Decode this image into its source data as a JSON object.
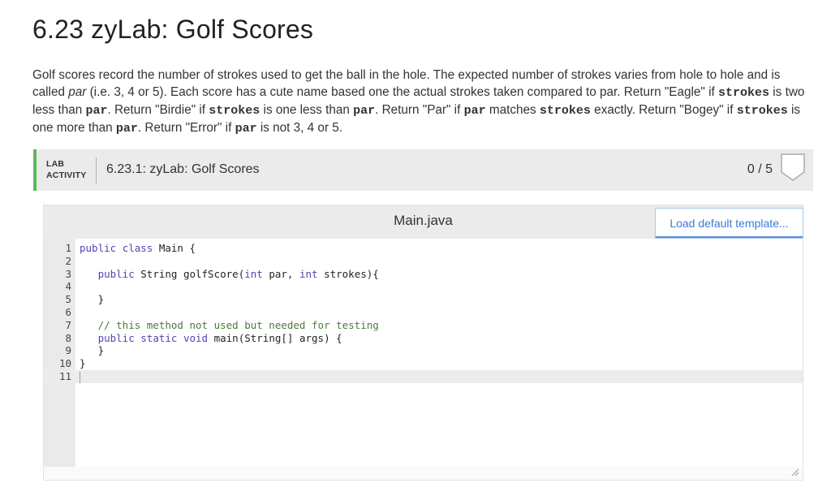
{
  "page": {
    "title": "6.23 zyLab: Golf Scores",
    "description": [
      {
        "t": "text",
        "v": "Golf scores record the number of strokes used to get the ball in the hole. The expected number of strokes varies from hole to hole and is called "
      },
      {
        "t": "em",
        "v": "par"
      },
      {
        "t": "text",
        "v": " (i.e. 3, 4 or 5). Each score has a cute name based one the actual strokes taken compared to par. Return \"Eagle\" if "
      },
      {
        "t": "code",
        "v": "strokes"
      },
      {
        "t": "text",
        "v": " is two less than "
      },
      {
        "t": "code",
        "v": "par"
      },
      {
        "t": "text",
        "v": ". Return \"Birdie\" if "
      },
      {
        "t": "code",
        "v": "strokes"
      },
      {
        "t": "text",
        "v": " is one less than "
      },
      {
        "t": "code",
        "v": "par"
      },
      {
        "t": "text",
        "v": ". Return \"Par\" if "
      },
      {
        "t": "code",
        "v": "par"
      },
      {
        "t": "text",
        "v": " matches "
      },
      {
        "t": "code",
        "v": "strokes"
      },
      {
        "t": "text",
        "v": " exactly. Return \"Bogey\" if "
      },
      {
        "t": "code",
        "v": "strokes"
      },
      {
        "t": "text",
        "v": " is one more than "
      },
      {
        "t": "code",
        "v": "par"
      },
      {
        "t": "text",
        "v": ". Return \"Error\" if "
      },
      {
        "t": "code",
        "v": "par"
      },
      {
        "t": "text",
        "v": " is not 3, 4 or 5."
      }
    ]
  },
  "lab": {
    "label_line1": "LAB",
    "label_line2": "ACTIVITY",
    "title": "6.23.1: zyLab: Golf Scores",
    "score": "0 / 5",
    "accent_color": "#5cb85c",
    "badge_icon": "shield-outline-icon"
  },
  "editor": {
    "filename": "Main.java",
    "load_button": "Load default template...",
    "lines": [
      {
        "n": "1",
        "code": "public class Main {"
      },
      {
        "n": "2",
        "code": ""
      },
      {
        "n": "3",
        "code": "   public String golfScore(int par, int strokes){"
      },
      {
        "n": "4",
        "code": ""
      },
      {
        "n": "5",
        "code": "   }"
      },
      {
        "n": "6",
        "code": ""
      },
      {
        "n": "7",
        "code": "   // this method not used but needed for testing"
      },
      {
        "n": "8",
        "code": "   public static void main(String[] args) {"
      },
      {
        "n": "9",
        "code": "   }"
      },
      {
        "n": "10",
        "code": "}"
      },
      {
        "n": "11",
        "code": ""
      }
    ],
    "active_line": "11"
  }
}
